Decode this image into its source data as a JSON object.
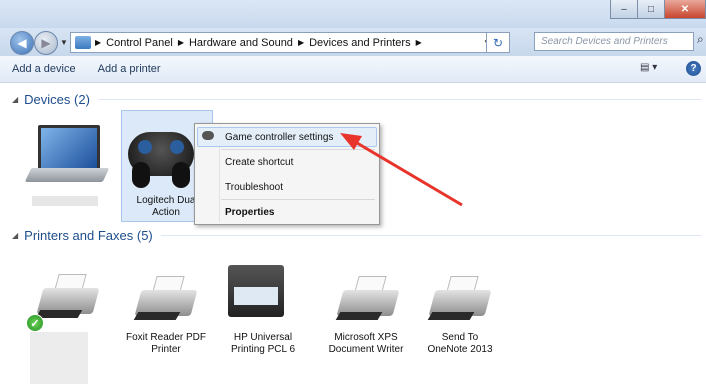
{
  "window": {
    "minimize_glyph": "–",
    "maximize_glyph": "□",
    "close_glyph": "✕"
  },
  "address": {
    "crumbs": [
      "Control Panel",
      "Hardware and Sound",
      "Devices and Printers"
    ],
    "separator": "▶",
    "search_placeholder": "Search Devices and Printers"
  },
  "toolbar": {
    "add_device": "Add a device",
    "add_printer": "Add a printer"
  },
  "groups": {
    "devices": "Devices (2)",
    "printers": "Printers and Faxes (5)"
  },
  "devices": [
    {
      "label": "",
      "icon": "laptop-icon"
    },
    {
      "label_line1": "Logitech Dua",
      "label_line2": "Action",
      "icon": "gamepad-icon"
    }
  ],
  "context_menu": {
    "items": [
      "Game controller settings",
      "Create shortcut",
      "Troubleshoot",
      "Properties"
    ]
  },
  "printers": [
    {
      "line1": "",
      "line2": "",
      "icon": "printer-icon",
      "default": true
    },
    {
      "line1": "Foxit Reader PDF",
      "line2": "Printer",
      "icon": "printer-icon"
    },
    {
      "line1": "HP Universal",
      "line2": "Printing PCL 6",
      "icon": "multifunction-printer-icon"
    },
    {
      "line1": "Microsoft XPS",
      "line2": "Document Writer",
      "icon": "printer-icon"
    },
    {
      "line1": "Send To",
      "line2": "OneNote 2013",
      "icon": "printer-icon"
    }
  ],
  "colors": {
    "annotation_arrow": "#e8342a",
    "group_header": "#1e4e8c",
    "selection": "#dce9f8"
  }
}
